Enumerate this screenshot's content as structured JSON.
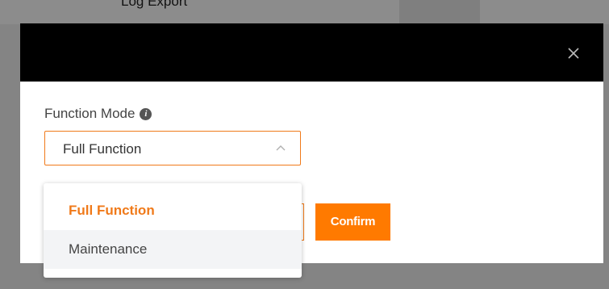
{
  "background": {
    "tab_label": "Log Export"
  },
  "dialog": {
    "close_icon": "close-icon",
    "field_label": "Function Mode",
    "info_icon_glyph": "i",
    "select": {
      "value": "Full Function",
      "state": "open"
    },
    "cancel_label": "",
    "confirm_label": "Confirm"
  },
  "dropdown": {
    "options": [
      {
        "label": "Full Function",
        "selected": true
      },
      {
        "label": "Maintenance",
        "selected": false
      }
    ]
  },
  "colors": {
    "accent": "#f07a1a",
    "button_primary": "#ff7a00",
    "header": "#000000"
  }
}
